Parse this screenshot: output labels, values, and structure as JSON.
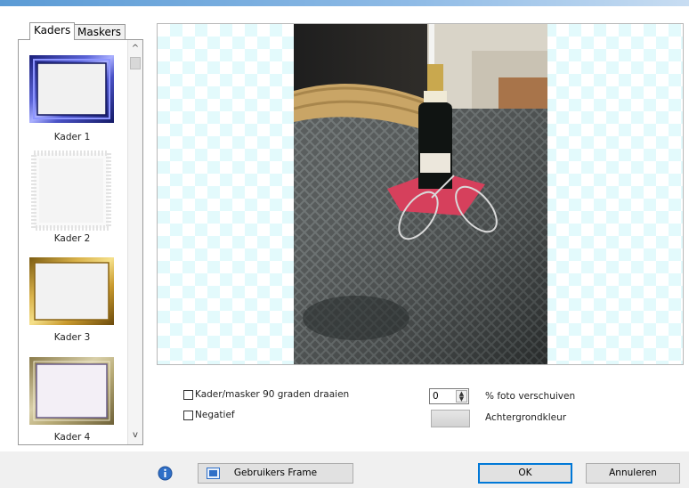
{
  "tabs": [
    {
      "label": "Kaders",
      "active": true
    },
    {
      "label": "Maskers",
      "active": false
    }
  ],
  "frames": [
    {
      "label": "Kader 1",
      "style": "blue-metallic"
    },
    {
      "label": "Kader 2",
      "style": "white-stitched"
    },
    {
      "label": "Kader 3",
      "style": "gold"
    },
    {
      "label": "Kader 4",
      "style": "silver-gold"
    }
  ],
  "scroll": {
    "up_glyph": "^",
    "down_glyph": "v"
  },
  "options": {
    "rotate_label": "Kader/masker 90 graden draaien",
    "rotate_checked": false,
    "negative_label": "Negatief",
    "negative_checked": false,
    "shift_value": "0",
    "shift_label": "% foto verschuiven",
    "bgcolor_label": "Achtergrondkleur"
  },
  "bottom": {
    "info_icon": "info-icon",
    "user_frame_label": "Gebruikers Frame",
    "ok_label": "OK",
    "cancel_label": "Annuleren"
  },
  "colors": {
    "accent": "#0078d7",
    "checker": "#e3fafc",
    "top_strip": "#5b9bd5"
  }
}
